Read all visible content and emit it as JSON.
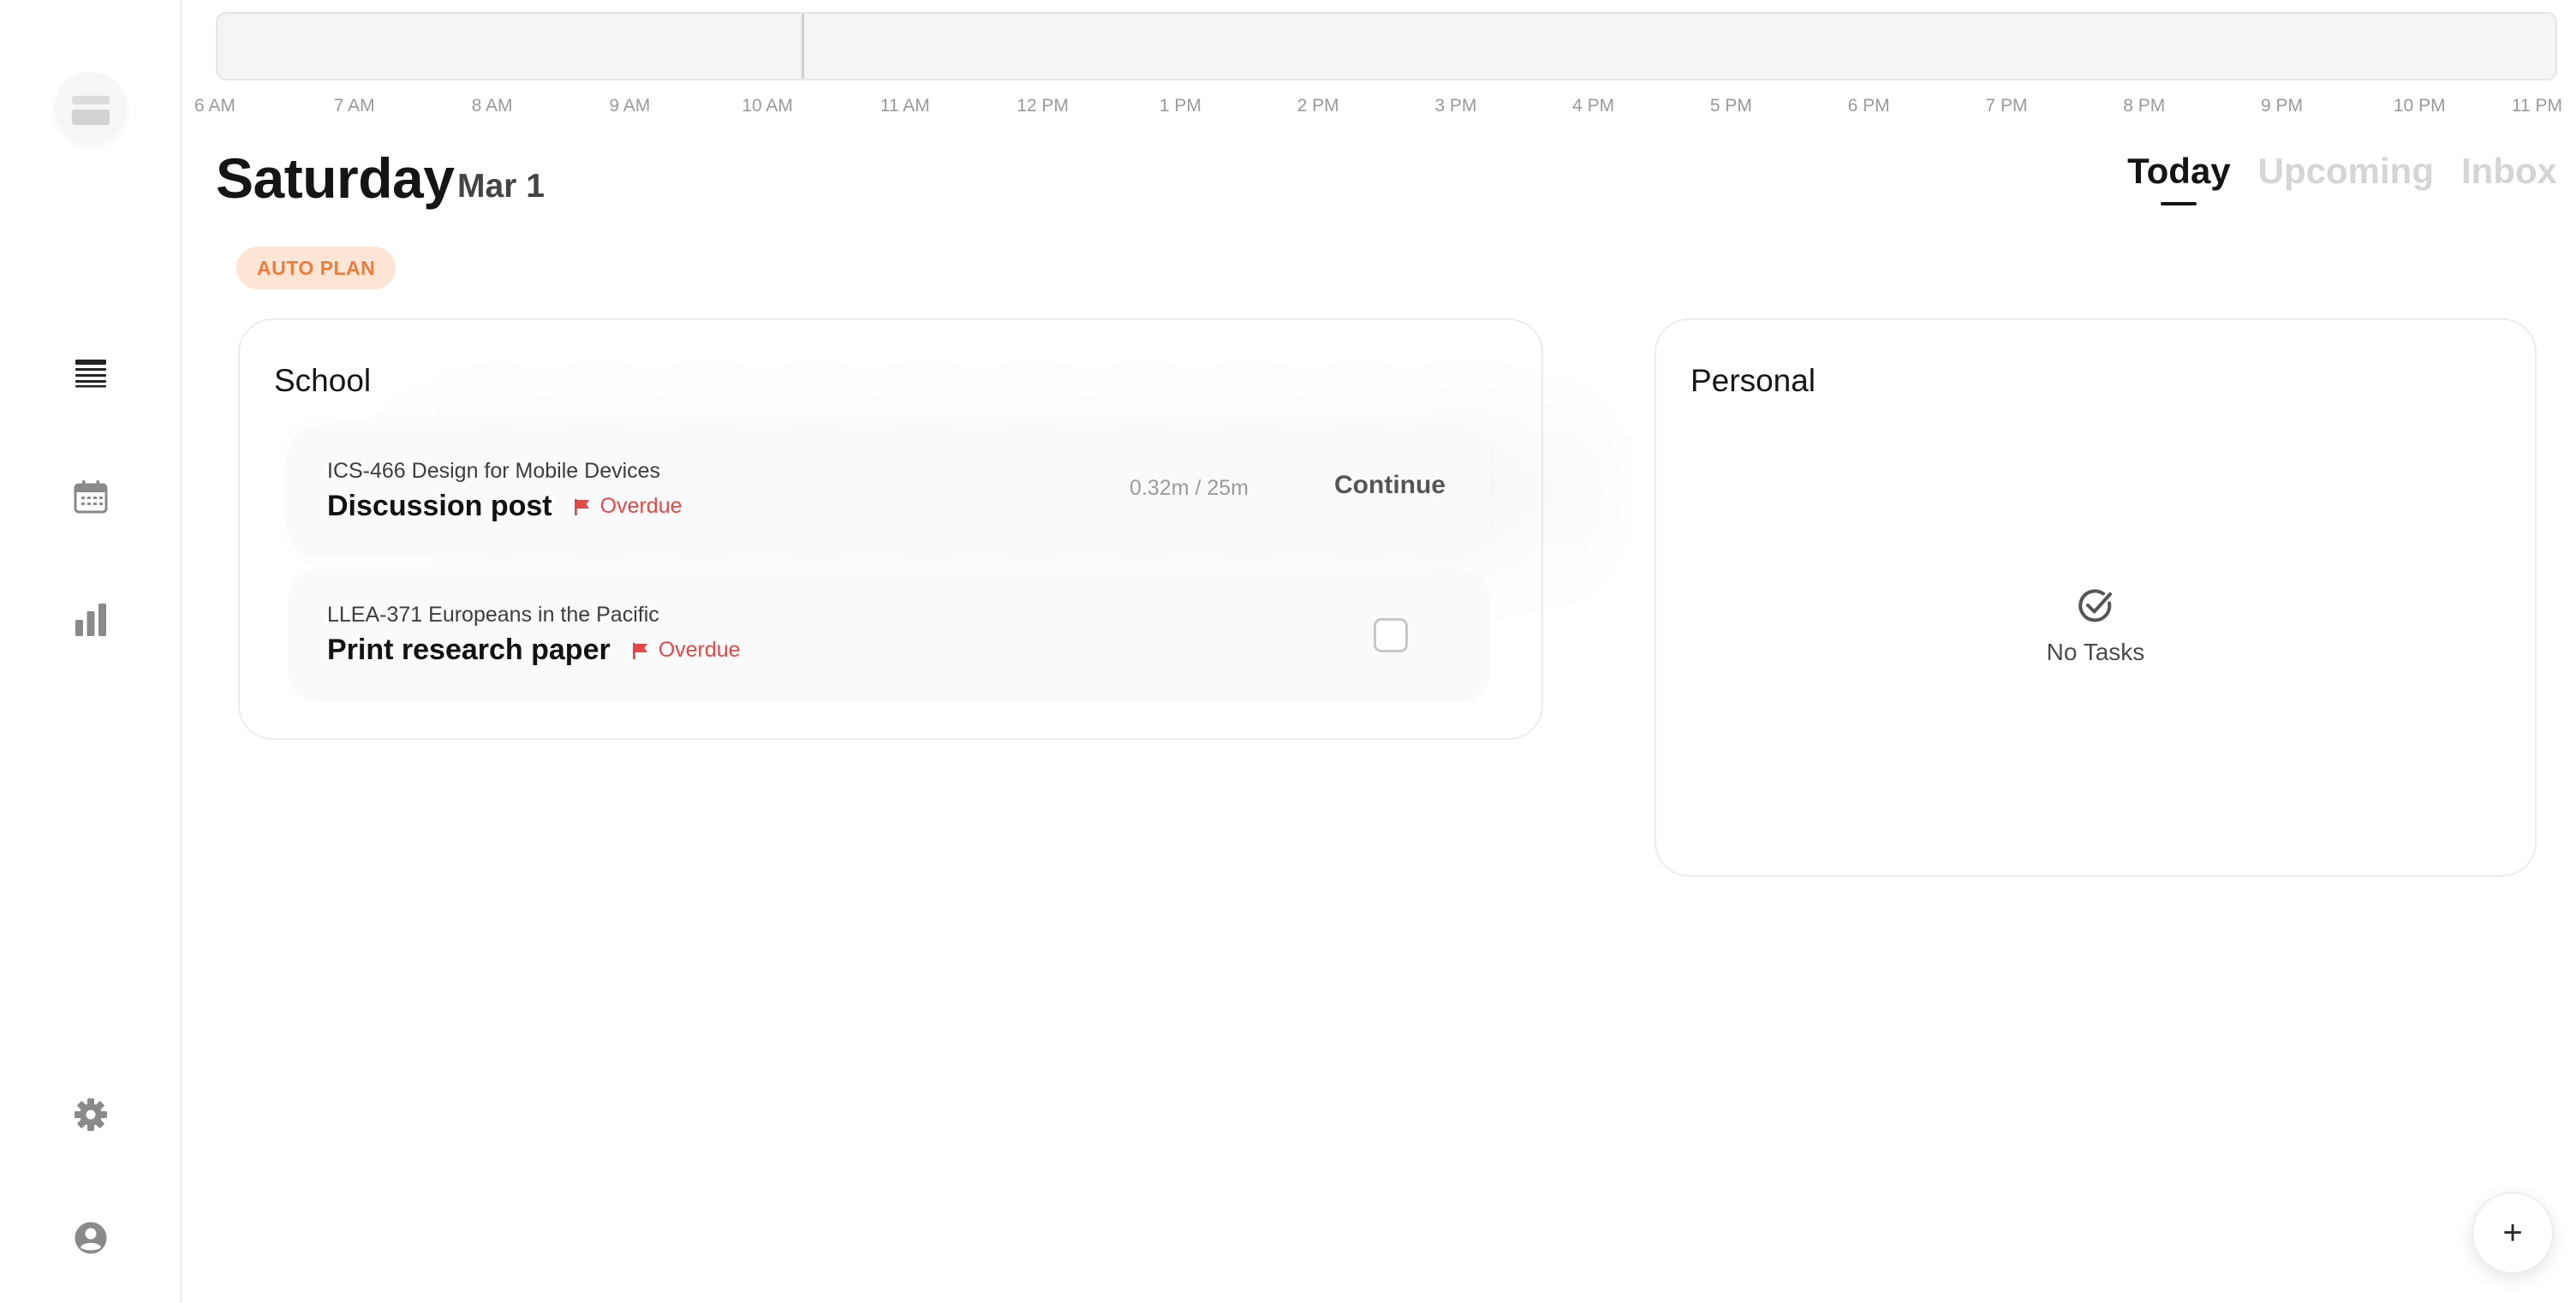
{
  "sidebar": {
    "items": [
      {
        "name": "list-icon",
        "label": "Today list"
      },
      {
        "name": "calendar-icon",
        "label": "Calendar"
      },
      {
        "name": "chart-icon",
        "label": "Stats"
      }
    ],
    "bottom": [
      {
        "name": "gear-icon"
      },
      {
        "name": "user-icon"
      }
    ]
  },
  "timeline": {
    "hours": [
      "6 AM",
      "7 AM",
      "8 AM",
      "9 AM",
      "10 AM",
      "11 AM",
      "12 PM",
      "1 PM",
      "2 PM",
      "3 PM",
      "4 PM",
      "5 PM",
      "6 PM",
      "7 PM",
      "8 PM",
      "9 PM",
      "10 PM",
      "11 PM"
    ]
  },
  "header": {
    "day": "Saturday",
    "date": "Mar 1",
    "tabs": [
      {
        "label": "Today",
        "active": true
      },
      {
        "label": "Upcoming",
        "active": false
      },
      {
        "label": "Inbox",
        "active": false
      }
    ]
  },
  "auto_plan": {
    "label": "AUTO PLAN"
  },
  "school": {
    "title": "School",
    "tasks": [
      {
        "course": "ICS-466 Design for Mobile Devices",
        "name": "Discussion post",
        "status": "Overdue",
        "timer": "0.32m / 25m",
        "action": "Continue"
      },
      {
        "course": "LLEA-371 Europeans in the Pacific",
        "name": "Print research paper",
        "status": "Overdue",
        "checked": false
      }
    ]
  },
  "personal": {
    "title": "Personal",
    "empty_text": "No Tasks"
  },
  "fab": {
    "label": "+"
  },
  "colors": {
    "accent_orange": "#f07c3c",
    "auto_plan_bg": "#fde5d6",
    "overdue_red": "#e54848",
    "muted_tab": "#d5d5d5"
  }
}
